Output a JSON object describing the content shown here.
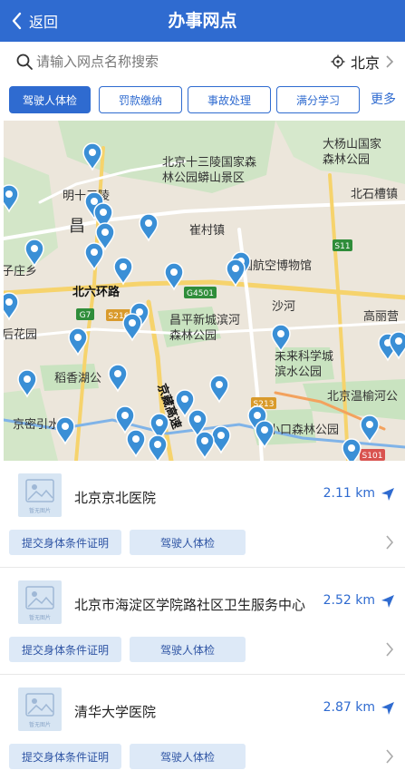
{
  "header": {
    "back_label": "返回",
    "title": "办事网点"
  },
  "search": {
    "placeholder": "请输入网点名称搜索",
    "city": "北京"
  },
  "tabs": [
    {
      "label": "驾驶人体检",
      "active": true
    },
    {
      "label": "罚款缴纳",
      "active": false
    },
    {
      "label": "事故处理",
      "active": false
    },
    {
      "label": "满分学习",
      "active": false
    }
  ],
  "tabs_more": "更多",
  "map": {
    "labels": {
      "shisanling": "北京十三陵国家森",
      "shisanling2": "林公园蟒山景区",
      "dayang": "大杨山国家",
      "dayang2": "森林公园",
      "ming13": "明十三陵",
      "beishicao": "北石槽镇",
      "cuicun": "崔村镇",
      "chang": "昌",
      "hangkong": "国航空博物馆",
      "beiliuhuan": "北六环路",
      "shahe": "沙河",
      "zhuang": "子庄乡",
      "changpingxin": "昌平新城滨河",
      "changpingxin2": "森林公园",
      "houhua": "后花园",
      "daotiao": "稻香湖公",
      "weilai": "未来科学城",
      "weilai2": "滨水公园",
      "gaoli": "高丽营",
      "jingzang": "京藏高速",
      "wenyu": "北京温榆河公",
      "xiaokou": "小口森林公园",
      "jingmi": "京密引水渠",
      "road_s11": "S11",
      "road_g4501": "G4501",
      "road_g7": "G7",
      "road_s216": "S216",
      "road_s213": "S213",
      "road_s101": "S101"
    }
  },
  "list": [
    {
      "name": "北京京北医院",
      "distance": "2.11 km",
      "tags": [
        "提交身体条件证明",
        "驾驶人体检"
      ],
      "thumb_caption": "暂无图片"
    },
    {
      "name": "北京市海淀区学院路社区卫生服务中心",
      "distance": "2.52 km",
      "tags": [
        "提交身体条件证明",
        "驾驶人体检"
      ],
      "thumb_caption": "暂无图片"
    },
    {
      "name": "清华大学医院",
      "distance": "2.87 km",
      "tags": [
        "提交身体条件证明",
        "驾驶人体检"
      ],
      "thumb_caption": "暂无图片"
    }
  ],
  "colors": {
    "brand": "#2f6bd0",
    "pin": "#3a8fd6",
    "park": "#c9e3c0",
    "road": "#f6d36c"
  }
}
